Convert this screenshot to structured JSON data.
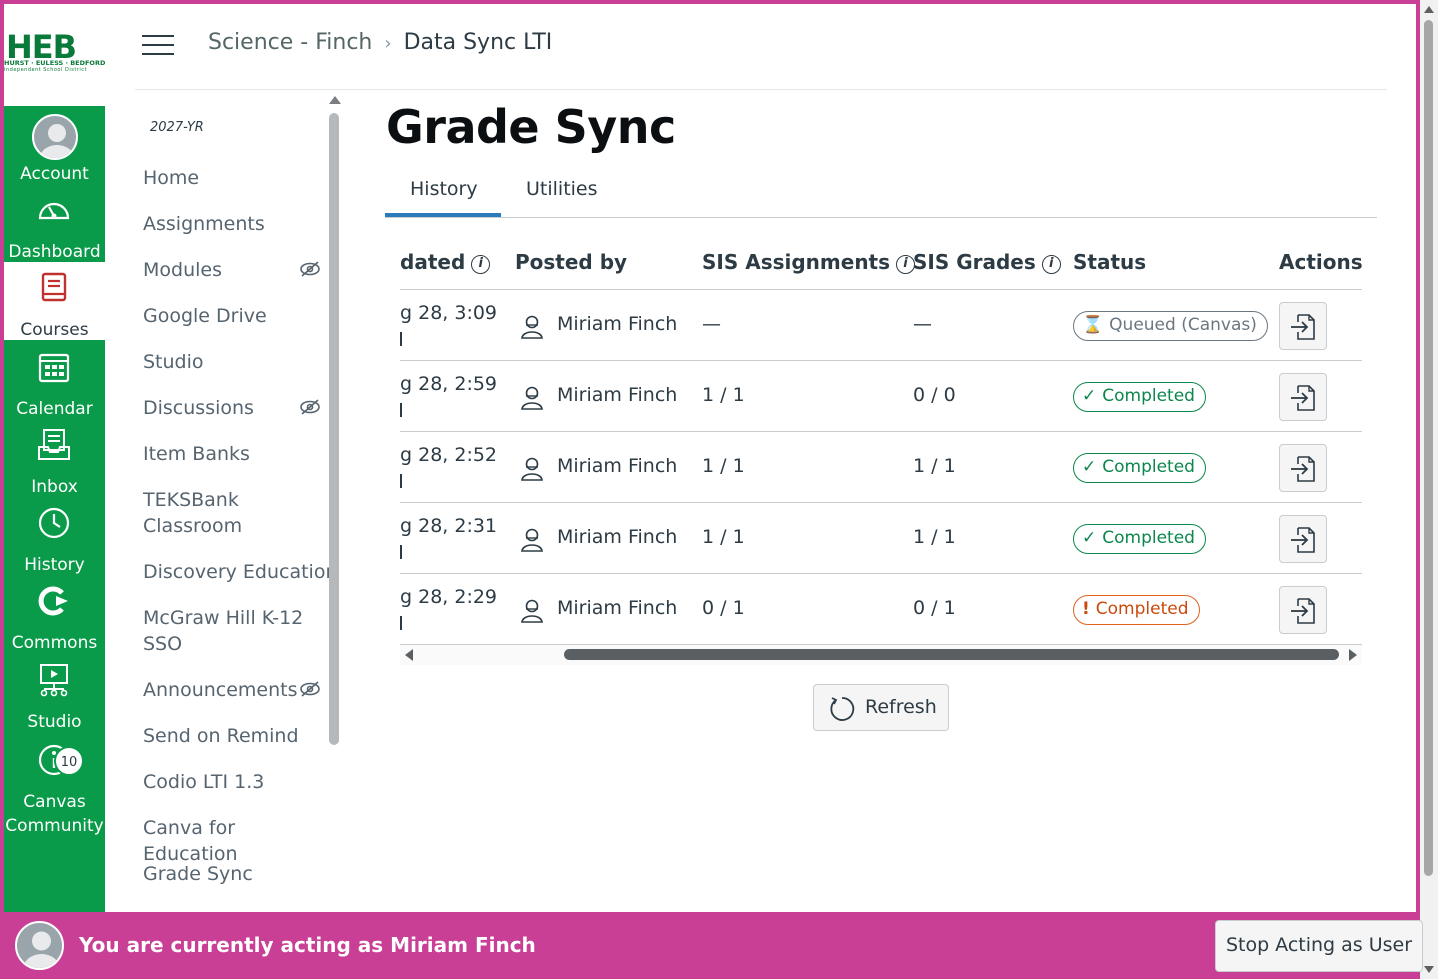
{
  "logo": {
    "text": "HEB",
    "line1": "HURST · EULESS · BEDFORD",
    "line2": "Independent School District"
  },
  "global_nav": [
    {
      "label": "Account",
      "icon": "avatar-icon"
    },
    {
      "label": "Dashboard",
      "icon": "dashboard-icon"
    },
    {
      "label": "Courses",
      "icon": "courses-icon",
      "active": true
    },
    {
      "label": "Calendar",
      "icon": "calendar-icon"
    },
    {
      "label": "Inbox",
      "icon": "inbox-icon"
    },
    {
      "label": "History",
      "icon": "clock-icon"
    },
    {
      "label": "Commons",
      "icon": "commons-icon"
    },
    {
      "label": "Studio",
      "icon": "studio-icon"
    },
    {
      "label": "Canvas Community",
      "icon": "community-icon",
      "badge": "10"
    }
  ],
  "breadcrumb": {
    "course": "Science - Finch",
    "page": "Data Sync LTI"
  },
  "course_nav": {
    "term": "2027-YR",
    "items": [
      {
        "label": "Home"
      },
      {
        "label": "Assignments"
      },
      {
        "label": "Modules",
        "hidden": true
      },
      {
        "label": "Google Drive"
      },
      {
        "label": "Studio"
      },
      {
        "label": "Discussions",
        "hidden": true
      },
      {
        "label": "Item Banks"
      },
      {
        "label": "TEKSBank Classroom"
      },
      {
        "label": "Discovery Education"
      },
      {
        "label": "McGraw Hill K-12 SSO"
      },
      {
        "label": "Announcements",
        "hidden": true
      },
      {
        "label": "Send on Remind"
      },
      {
        "label": "Codio LTI 1.3"
      },
      {
        "label": "Canva for Education"
      },
      {
        "label": "Grade Sync"
      }
    ]
  },
  "page_title": "Grade Sync",
  "tabs": [
    {
      "label": "History",
      "active": true
    },
    {
      "label": "Utilities"
    }
  ],
  "table": {
    "headers": {
      "updated": "dated",
      "posted_by": "Posted by",
      "sis_assignments": "SIS Assignments",
      "sis_grades": "SIS Grades",
      "status": "Status",
      "actions": "Actions"
    },
    "info_glyph": "i",
    "rows": [
      {
        "updated": "g 28, 3:09",
        "posted_by": "Miriam Finch",
        "sis_assignments": "—",
        "sis_grades": "—",
        "status": "Queued (Canvas)",
        "status_type": "queued",
        "status_icon": "⌛"
      },
      {
        "updated": "g 28, 2:59",
        "posted_by": "Miriam Finch",
        "sis_assignments": "1 / 1",
        "sis_grades": "0 / 0",
        "status": "Completed",
        "status_type": "ok",
        "status_icon": "✓"
      },
      {
        "updated": "g 28, 2:52",
        "posted_by": "Miriam Finch",
        "sis_assignments": "1 / 1",
        "sis_grades": "1 / 1",
        "status": "Completed",
        "status_type": "ok",
        "status_icon": "✓"
      },
      {
        "updated": "g 28, 2:31",
        "posted_by": "Miriam Finch",
        "sis_assignments": "1 / 1",
        "sis_grades": "1 / 1",
        "status": "Completed",
        "status_type": "ok",
        "status_icon": "✓"
      },
      {
        "updated": "g 28, 2:29",
        "posted_by": "Miriam Finch",
        "sis_assignments": "0 / 1",
        "sis_grades": "0 / 1",
        "status": "Completed",
        "status_type": "err",
        "status_icon": "!"
      }
    ]
  },
  "refresh_label": "Refresh",
  "masquerade": {
    "text": "You are currently acting as Miriam Finch",
    "stop_label": "Stop Acting as User"
  },
  "colors": {
    "nav_green": "#0a9b4a",
    "masq_pink": "#c83f95",
    "tab_blue": "#2b7abc",
    "success": "#0b874b",
    "warning": "#e0621d"
  }
}
